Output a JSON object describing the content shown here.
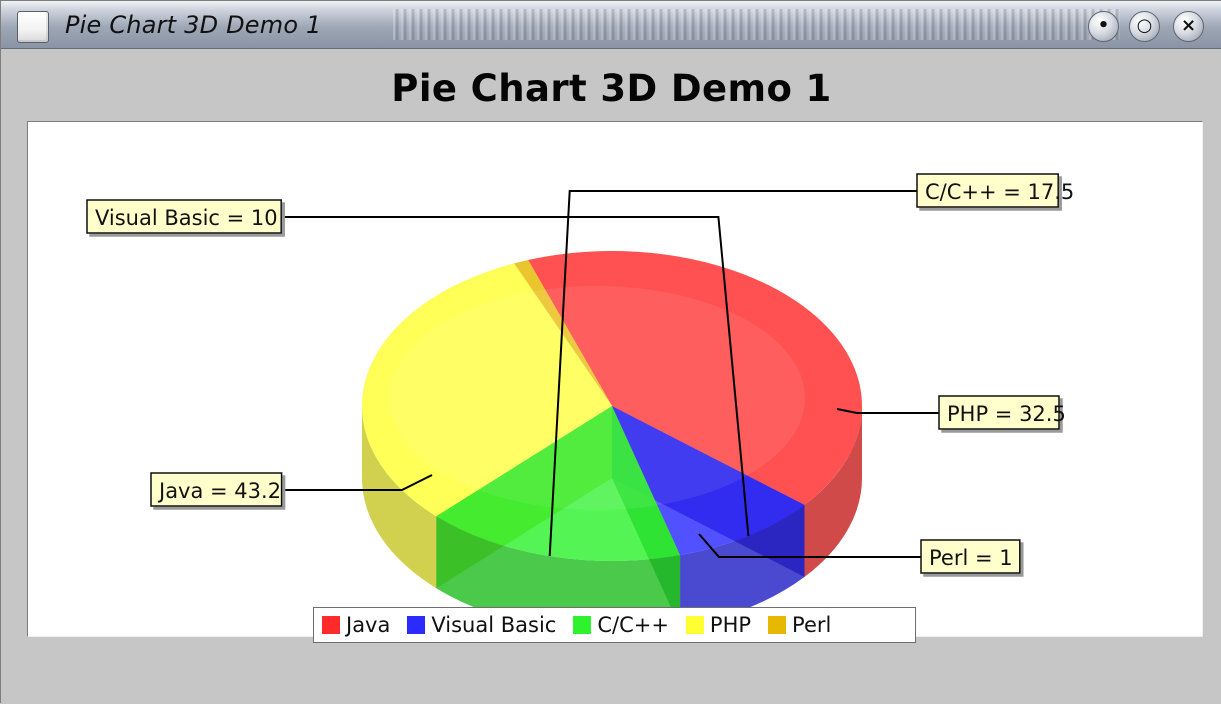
{
  "window": {
    "title": "Pie Chart 3D Demo 1",
    "buttons": [
      "minimize",
      "maximize",
      "close"
    ]
  },
  "chart_data": {
    "type": "pie",
    "title": "Pie Chart 3D Demo 1",
    "three_dimensional": true,
    "categories": [
      "Java",
      "Visual Basic",
      "C/C++",
      "PHP",
      "Perl"
    ],
    "values": [
      43.2,
      10,
      17.5,
      32.5,
      1
    ],
    "colors": [
      "#ff2b2b",
      "#2b2bff",
      "#2df22d",
      "#ffff33",
      "#e6b800"
    ],
    "labels": [
      "Java = 43.2",
      "Visual Basic = 10",
      "C/C++ = 17.5",
      "PHP = 32.5",
      "Perl = 1"
    ],
    "legend": {
      "placement": "bottom",
      "entries": [
        "Java",
        "Visual Basic",
        "C/C++",
        "PHP",
        "Perl"
      ]
    }
  }
}
